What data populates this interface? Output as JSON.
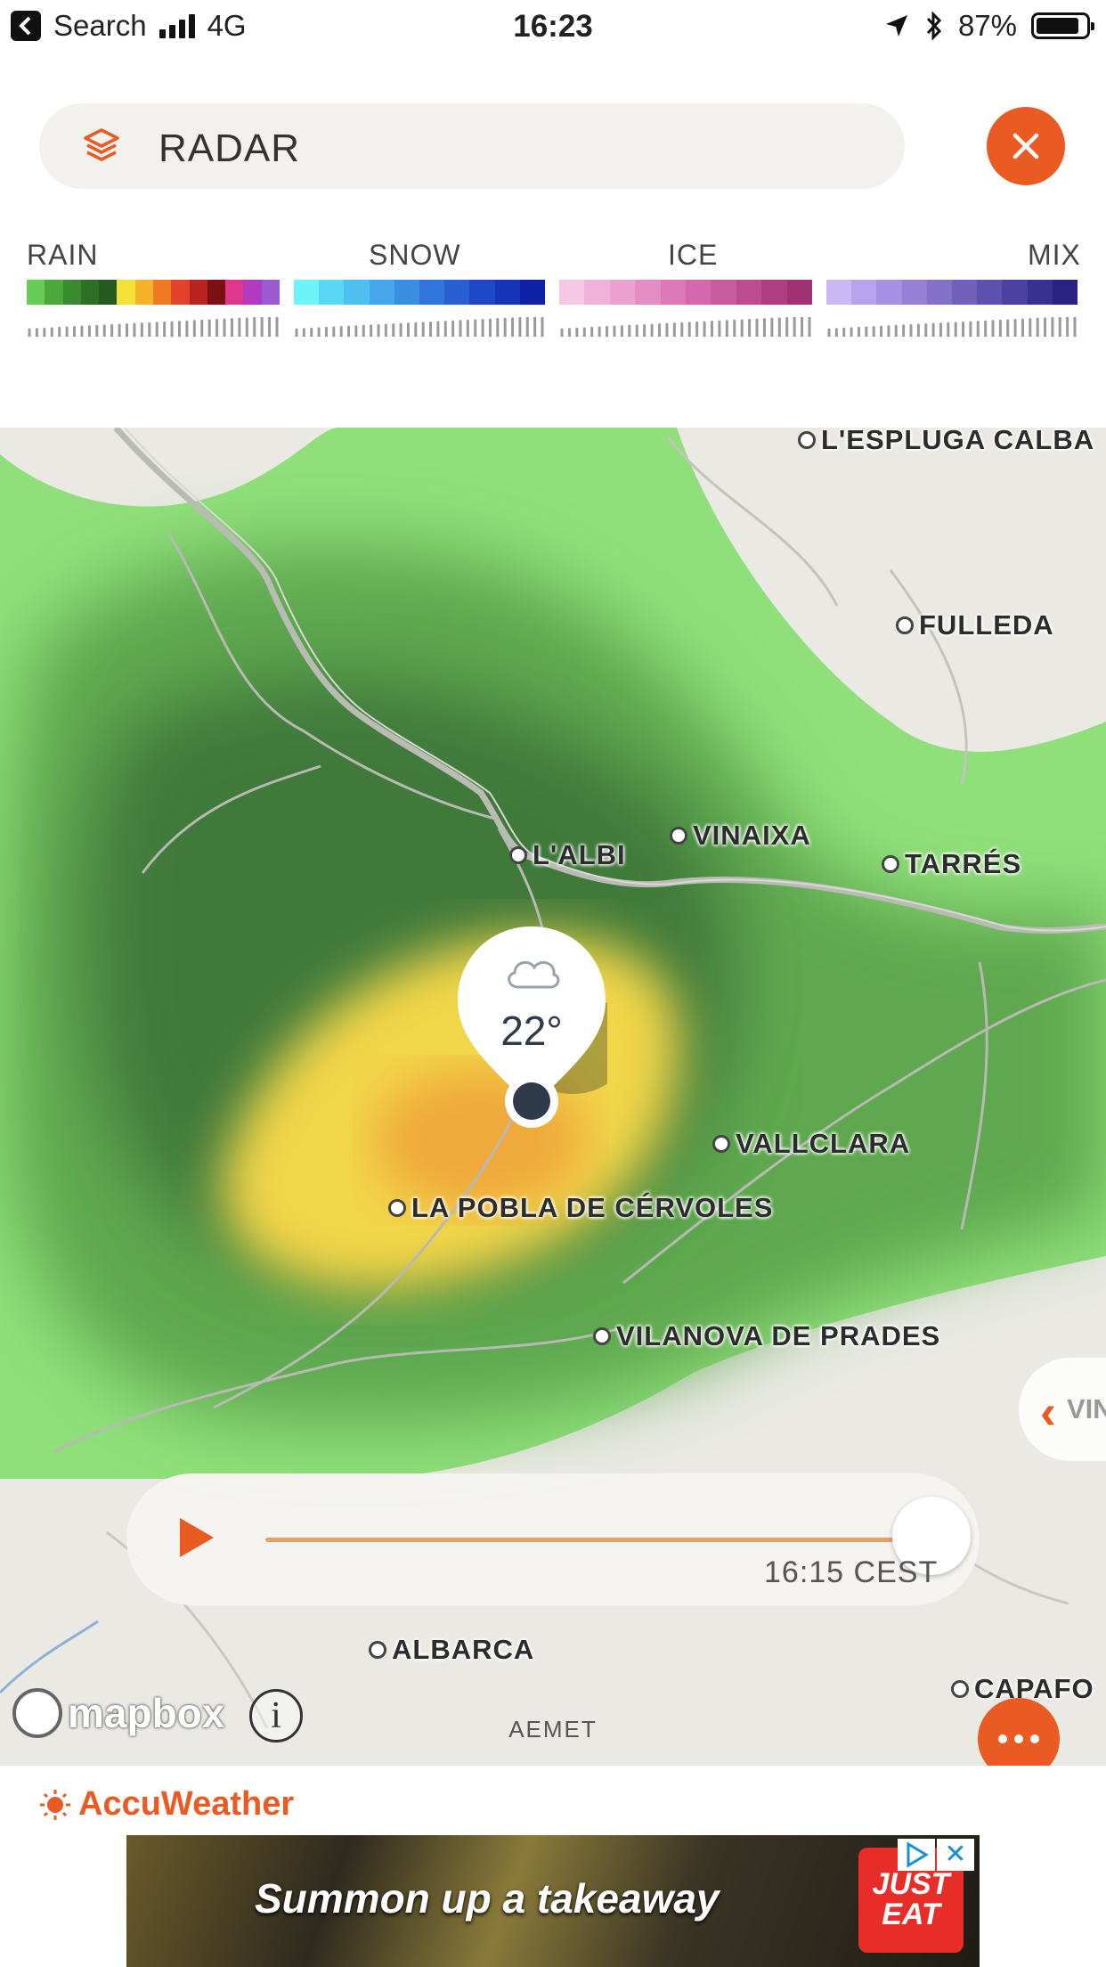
{
  "status_bar": {
    "back_label": "Search",
    "network": "4G",
    "time": "16:23",
    "battery": "87%",
    "battery_level": 0.87
  },
  "search": {
    "label": "RADAR"
  },
  "legend": [
    {
      "label": "RAIN",
      "colors": [
        "#66cc55",
        "#4aa83c",
        "#3a8a30",
        "#2e6f26",
        "#255a1e",
        "#f6e03a",
        "#f4b328",
        "#ef7a22",
        "#e2422a",
        "#b82220",
        "#7a1010",
        "#e0378c",
        "#b03ac0",
        "#9b5ad0"
      ]
    },
    {
      "label": "SNOW",
      "colors": [
        "#6ef3f8",
        "#5ad7f5",
        "#4dc0f0",
        "#45a8ec",
        "#3a8fe4",
        "#2f75dc",
        "#2860d4",
        "#1e48c8",
        "#1634b8",
        "#0e20a6"
      ]
    },
    {
      "label": "ICE",
      "colors": [
        "#f6c8e6",
        "#f0b2da",
        "#eaa0d0",
        "#e48cc4",
        "#dd78b8",
        "#d468ac",
        "#c85a9e",
        "#bc4c90",
        "#ae3e82",
        "#a03274"
      ]
    },
    {
      "label": "MIX",
      "colors": [
        "#c8b8f4",
        "#b8a4ec",
        "#a690e2",
        "#9480d6",
        "#8270ca",
        "#7060bc",
        "#5e50ae",
        "#4c40a0",
        "#3a3090",
        "#2a2280"
      ]
    }
  ],
  "map": {
    "towns": [
      {
        "name": "L'ESPLUGA CALBA"
      },
      {
        "name": "FULLEDA"
      },
      {
        "name": "VINAIXA"
      },
      {
        "name": "L'ALBI"
      },
      {
        "name": "TARRÉS"
      },
      {
        "name": "VALLCLARA"
      },
      {
        "name": "LA POBLA DE CÉRVOLES"
      },
      {
        "name": "VILANOVA DE PRADES"
      },
      {
        "name": "ALBARCA"
      },
      {
        "name": "CAPAFO"
      }
    ],
    "pin_temp": "22°",
    "side_label": "VIN",
    "attribution": "AEMET",
    "mapbox": "mapbox"
  },
  "player": {
    "time": "16:15 CEST",
    "progress": 0.99
  },
  "footer": {
    "brand": "AccuWeather",
    "ad_text": "Summon up a takeaway",
    "ad_brand_line1": "JUST",
    "ad_brand_line2": "EAT"
  },
  "colors": {
    "accent": "#ea5a23",
    "rain_light": "#8fdf7a",
    "rain_dark": "#3f7a3a"
  }
}
